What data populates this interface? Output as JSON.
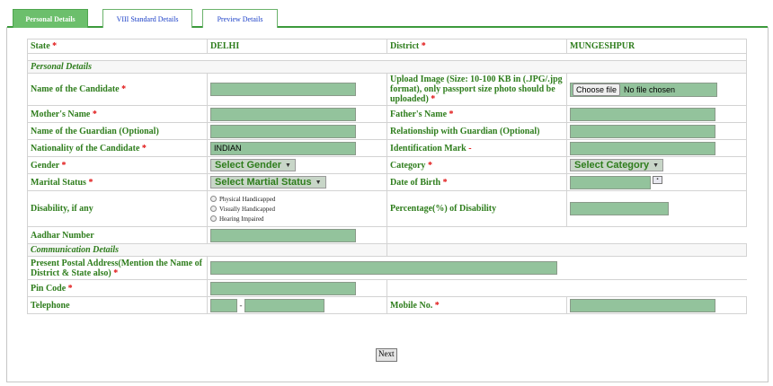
{
  "tabs": [
    {
      "label": "Personal Details",
      "active": true
    },
    {
      "label": "VIII Standard Details",
      "active": false
    },
    {
      "label": "Preview Details",
      "active": false
    }
  ],
  "header": {
    "state_label": "State",
    "state_value": "DELHI",
    "district_label": "District",
    "district_value": "MUNGESHPUR"
  },
  "sections": {
    "personal": "Personal Details",
    "communication": "Communication Details"
  },
  "required_mark": "*",
  "fields": {
    "candidate_name": "Name of the Candidate",
    "upload_image": "Upload Image (Size: 10-100 KB in (.JPG/.jpg format), only passport size photo should be uploaded)",
    "mother_name": "Mother's Name",
    "father_name": "Father's Name",
    "guardian_name": "Name of the Guardian (Optional)",
    "guardian_relationship": "Relationship with Guardian (Optional)",
    "nationality": "Nationality of the Candidate",
    "identification_mark": "Identification Mark",
    "identification_mark_req": "-",
    "gender": "Gender",
    "category": "Category",
    "marital_status": "Marital Status",
    "dob": "Date of Birth",
    "disability": "Disability, if any",
    "disability_percentage": "Percentage(%) of Disability",
    "aadhar": "Aadhar Number",
    "postal_address": "Present Postal Address(Mention the Name of District & State also)",
    "pin_code": "Pin Code",
    "telephone": "Telephone",
    "mobile": "Mobile No.",
    "telephone_sep": "-"
  },
  "values": {
    "nationality": "INDIAN"
  },
  "selects": {
    "gender": "Select Gender",
    "category": "Select Category",
    "marital_status": "Select Martial Status"
  },
  "file_input": {
    "button": "Choose file",
    "status": "No file chosen"
  },
  "disability_options": [
    "Physical Handicapped",
    "Visually Handicapped",
    "Hearing Impaired"
  ],
  "buttons": {
    "next": "Next"
  },
  "icons": {
    "dropdown": "▼",
    "calendar": "calendar-icon"
  }
}
